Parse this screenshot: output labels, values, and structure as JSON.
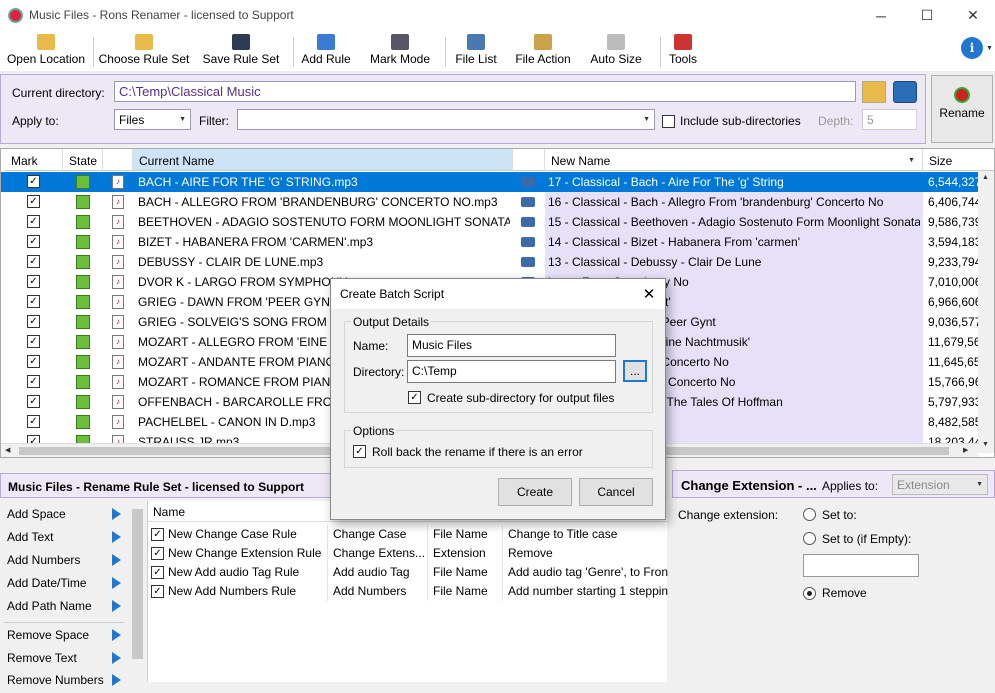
{
  "window": {
    "title": "Music Files - Rons Renamer - licensed to Support"
  },
  "toolbar": [
    "Open Location",
    "Choose Rule Set",
    "Save Rule Set",
    "Add Rule",
    "Mark Mode",
    "File List",
    "File Action",
    "Auto Size",
    "Tools"
  ],
  "dir": {
    "current_label": "Current directory:",
    "current_value": "C:\\Temp\\Classical Music",
    "apply_label": "Apply to:",
    "apply_value": "Files",
    "filter_label": "Filter:",
    "filter_value": "",
    "include_label": "Include sub-directories",
    "depth_label": "Depth:",
    "depth_value": "5",
    "rename_label": "Rename"
  },
  "grid": {
    "headers": [
      "Mark",
      "State",
      "Current Name",
      "New Name",
      "Size"
    ],
    "rows": [
      {
        "cur": "BACH - AIRE FOR THE 'G' STRING.mp3",
        "new": "17 - Classical - Bach - Aire For The 'g' String",
        "size": "6,544,327"
      },
      {
        "cur": "BACH - ALLEGRO FROM 'BRANDENBURG' CONCERTO NO.mp3",
        "new": "16 - Classical - Bach - Allegro From 'brandenburg' Concerto No",
        "size": "6,406,744"
      },
      {
        "cur": "BEETHOVEN - ADAGIO SOSTENUTO FORM MOONLIGHT SONATA.mp3",
        "new": "15 - Classical - Beethoven - Adagio Sostenuto Form Moonlight Sonata",
        "size": "9,586,739"
      },
      {
        "cur": "BIZET - HABANERA FROM 'CARMEN'.mp3",
        "new": "14 - Classical - Bizet - Habanera From 'carmen'",
        "size": "3,594,183"
      },
      {
        "cur": "DEBUSSY - CLAIR DE LUNE.mp3",
        "new": "13 - Classical - Debussy - Clair De Lune",
        "size": "9,233,794"
      },
      {
        "cur": "DVOR K - LARGO FROM SYMPHONY",
        "new": "Largo From Symphony No",
        "size": "7,010,006"
      },
      {
        "cur": "GRIEG - DAWN FROM 'PEER GYNT'.mp3",
        "new": "Dawn From 'peer Gynt'",
        "size": "6,966,606"
      },
      {
        "cur": "GRIEG - SOLVEIG'S SONG FROM PEER",
        "new": "Solveig's Song From Peer Gynt",
        "size": "9,036,577"
      },
      {
        "cur": "MOZART - ALLEGRO FROM 'EINE KLE",
        "new": "Allegro From 'eine Kleine Nachtmusik'",
        "size": "11,679,563"
      },
      {
        "cur": "MOZART - ANDANTE FROM PIANO C",
        "new": "Andante From Piano Concerto No",
        "size": "11,645,655"
      },
      {
        "cur": "MOZART - ROMANCE FROM PIANO",
        "new": "Romance From Piano Concerto No",
        "size": "15,766,960"
      },
      {
        "cur": "OFFENBACH - BARCAROLLE FROM T",
        "new": "ach - Barcarolle From The Tales Of Hoffman",
        "size": "5,797,933"
      },
      {
        "cur": "PACHELBEL - CANON IN D.mp3",
        "new": "bel - Canon In D",
        "size": "8,482,585"
      },
      {
        "cur": "STRAUSS JR.mp3",
        "new": "lr",
        "size": "18,203,440"
      }
    ]
  },
  "ruleset": {
    "title": "Music Files - Rename Rule Set - licensed to Support",
    "actions": [
      "Add Space",
      "Add Text",
      "Add Numbers",
      "Add Date/Time",
      "Add Path Name",
      "Remove Space",
      "Remove Text",
      "Remove Numbers"
    ],
    "name_header": "Name",
    "rules": [
      {
        "name": "New Change Case Rule",
        "type": "Change Case",
        "applies": "File Name",
        "desc": "Change to Title case"
      },
      {
        "name": "New Change Extension Rule",
        "type": "Change Extens...",
        "applies": "Extension",
        "desc": "Remove"
      },
      {
        "name": "New Add audio Tag Rule",
        "type": "Add audio Tag",
        "applies": "File Name",
        "desc": "Add audio tag 'Genre', to Fron"
      },
      {
        "name": "New Add Numbers Rule",
        "type": "Add Numbers",
        "applies": "File Name",
        "desc": "Add number starting 1 steppin"
      }
    ]
  },
  "ext": {
    "title": "Change Extension - ...",
    "applies_label": "Applies to:",
    "applies_value": "Extension",
    "change_label": "Change extension:",
    "set_to": "Set to:",
    "set_empty": "Set to (if Empty):",
    "remove": "Remove"
  },
  "dialog": {
    "title": "Create Batch Script",
    "group1": "Output Details",
    "name_label": "Name:",
    "name_value": "Music Files",
    "dir_label": "Directory:",
    "dir_value": "C:\\Temp",
    "browse": "...",
    "subdir_label": "Create sub-directory for output files",
    "group2": "Options",
    "rollback_label": "Roll back the rename if there is an error",
    "create": "Create",
    "cancel": "Cancel"
  },
  "colors": {
    "accent": "#1f77d0",
    "panel": "#ede7f6",
    "selected": "#0078d7",
    "newname_bg": "#e6e0f8"
  }
}
